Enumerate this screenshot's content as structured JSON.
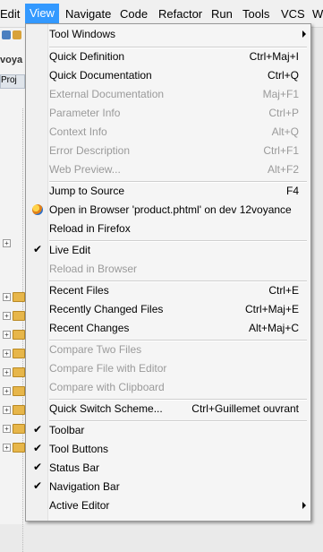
{
  "menubar": {
    "items": [
      {
        "label": "Edit"
      },
      {
        "label": "View"
      },
      {
        "label": "Navigate"
      },
      {
        "label": "Code"
      },
      {
        "label": "Refactor"
      },
      {
        "label": "Run"
      },
      {
        "label": "Tools"
      },
      {
        "label": "VCS"
      },
      {
        "label": "W"
      }
    ]
  },
  "background": {
    "breadcrumb_fragment": "voya",
    "project_tab_fragment": "Proj"
  },
  "menu": {
    "items": [
      {
        "label": "Tool Windows",
        "shortcut": "",
        "submenu": true,
        "enabled": true
      },
      {
        "label": "Quick Definition",
        "shortcut": "Ctrl+Maj+I",
        "enabled": true
      },
      {
        "label": "Quick Documentation",
        "shortcut": "Ctrl+Q",
        "enabled": true
      },
      {
        "label": "External Documentation",
        "shortcut": "Maj+F1",
        "enabled": false
      },
      {
        "label": "Parameter Info",
        "shortcut": "Ctrl+P",
        "enabled": false
      },
      {
        "label": "Context Info",
        "shortcut": "Alt+Q",
        "enabled": false
      },
      {
        "label": "Error Description",
        "shortcut": "Ctrl+F1",
        "enabled": false
      },
      {
        "label": "Web Preview...",
        "shortcut": "Alt+F2",
        "enabled": false
      },
      {
        "label": "Jump to Source",
        "shortcut": "F4",
        "enabled": true
      },
      {
        "label": "Open in Browser 'product.phtml' on dev 12voyance",
        "shortcut": "",
        "enabled": true,
        "icon": "browser-globe-icon"
      },
      {
        "label": "Reload in Firefox",
        "shortcut": "",
        "enabled": true
      },
      {
        "label": "Live Edit",
        "shortcut": "",
        "enabled": true,
        "checked": true
      },
      {
        "label": "Reload in Browser",
        "shortcut": "",
        "enabled": false
      },
      {
        "label": "Recent Files",
        "shortcut": "Ctrl+E",
        "enabled": true
      },
      {
        "label": "Recently Changed Files",
        "shortcut": "Ctrl+Maj+E",
        "enabled": true
      },
      {
        "label": "Recent Changes",
        "shortcut": "Alt+Maj+C",
        "enabled": true
      },
      {
        "label": "Compare Two Files",
        "shortcut": "",
        "enabled": false
      },
      {
        "label": "Compare File with Editor",
        "shortcut": "",
        "enabled": false
      },
      {
        "label": "Compare with Clipboard",
        "shortcut": "",
        "enabled": false
      },
      {
        "label": "Quick Switch Scheme...",
        "shortcut": "Ctrl+Guillemet ouvrant",
        "enabled": true
      },
      {
        "label": "Toolbar",
        "shortcut": "",
        "enabled": true,
        "checked": true
      },
      {
        "label": "Tool Buttons",
        "shortcut": "",
        "enabled": true,
        "checked": true
      },
      {
        "label": "Status Bar",
        "shortcut": "",
        "enabled": true,
        "checked": true
      },
      {
        "label": "Navigation Bar",
        "shortcut": "",
        "enabled": true,
        "checked": true
      },
      {
        "label": "Active Editor",
        "shortcut": "",
        "submenu": true,
        "enabled": true
      }
    ]
  },
  "colors": {
    "active_menu_bg": "#3399ff",
    "disabled_text": "#9a9a9a"
  }
}
